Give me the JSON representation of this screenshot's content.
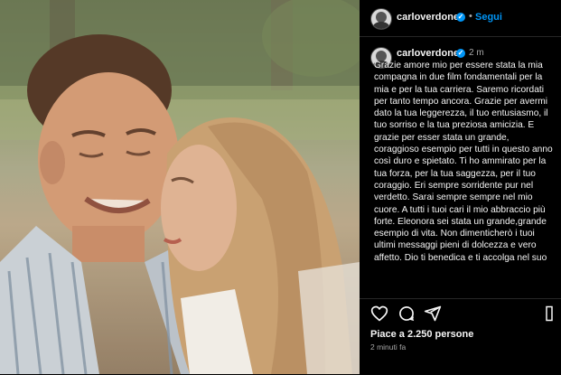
{
  "post": {
    "username": "carloverdone",
    "follow_label": "Segui",
    "separator": "•",
    "caption_time": "2 m",
    "caption": "Grazie amore mio per essere stata la mia compagna in due film fondamentali per la mia e per la tua carriera. Saremo ricordati per tanto tempo ancora. Grazie per avermi dato la tua leggerezza, il tuo entusiasmo, il tuo sorriso e la tua preziosa amicizia. E grazie per esser stata un grande, coraggioso esempio per tutti in questo anno così duro e spietato. Ti ho ammirato per la tua forza, per la tua saggezza, per il tuo coraggio. Eri sempre sorridente pur nel verdetto. Sarai sempre sempre nel mio cuore. A tutti i tuoi cari il mio abbraccio più forte. Eleonora sei stata un grande,grande esempio di vita. Non dimenticherò i tuoi ultimi messaggi pieni di dolcezza e vero affetto. Dio ti benedica e ti accolga nel suo",
    "likes": "Piace a 2.250 persone",
    "posted": "2 minuti fa"
  },
  "icons": {
    "verified": "verified-badge-icon",
    "like": "heart-icon",
    "comment": "comment-icon",
    "share": "send-icon",
    "more": "more-icon"
  },
  "colors": {
    "background": "#000000",
    "accent": "#0095f6",
    "muted": "#a8a8a8",
    "divider": "#262626"
  }
}
